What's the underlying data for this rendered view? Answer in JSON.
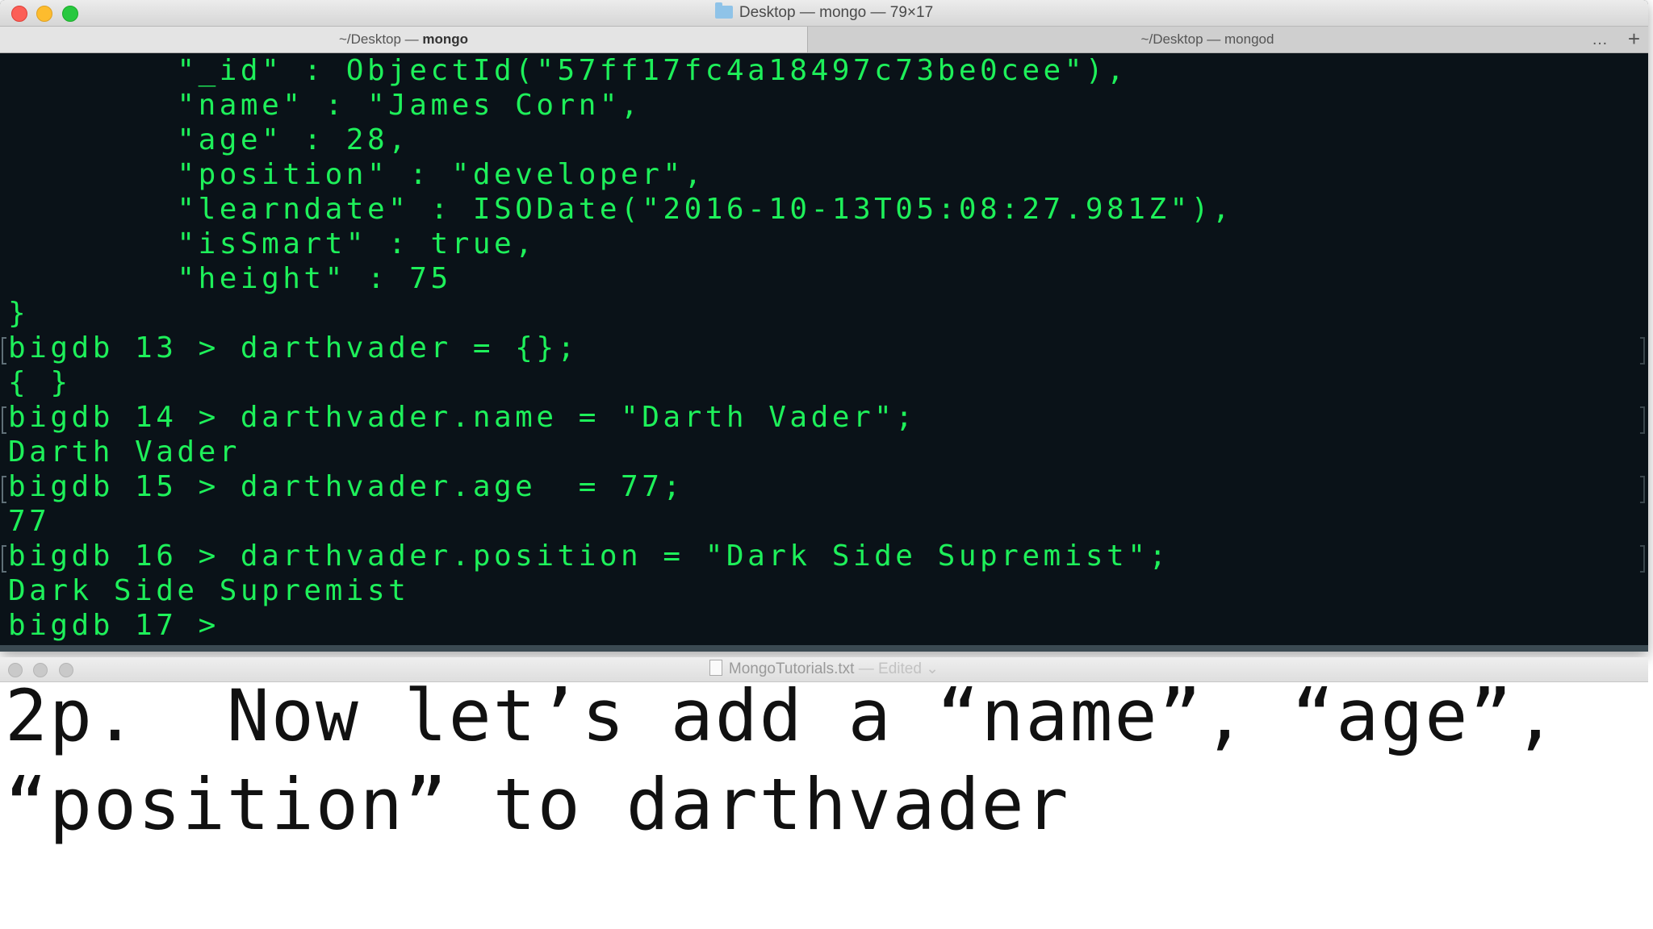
{
  "terminal": {
    "window_title": "Desktop — mongo — 79×17",
    "tabs": [
      {
        "prefix": "~/Desktop — ",
        "name": "mongo"
      },
      {
        "prefix": "~/Desktop — ",
        "name": "mongod"
      }
    ],
    "more_label": "…",
    "add_label": "+",
    "lines": [
      "        \"_id\" : ObjectId(\"57ff17fc4a18497c73be0cee\"),",
      "        \"name\" : \"James Corn\",",
      "        \"age\" : 28,",
      "        \"position\" : \"developer\",",
      "        \"learndate\" : ISODate(\"2016-10-13T05:08:27.981Z\"),",
      "        \"isSmart\" : true,",
      "        \"height\" : 75",
      "}",
      "bigdb 13 > darthvader = {};",
      "{ }",
      "bigdb 14 > darthvader.name = \"Darth Vader\";",
      "Darth Vader",
      "bigdb 15 > darthvader.age  = 77;",
      "77",
      "bigdb 16 > darthvader.position = \"Dark Side Supremist\";",
      "Dark Side Supremist",
      "bigdb 17 > "
    ]
  },
  "editor": {
    "file_name": "MongoTutorials.txt",
    "status": " — Edited",
    "lines": [
      "2p.  Now let’s add a “name”, “age”,",
      "“position” to darthvader"
    ]
  },
  "colors": {
    "terminal_bg": "#0a1218",
    "terminal_text": "#1ef05a",
    "editor_bg": "#ffffff"
  }
}
